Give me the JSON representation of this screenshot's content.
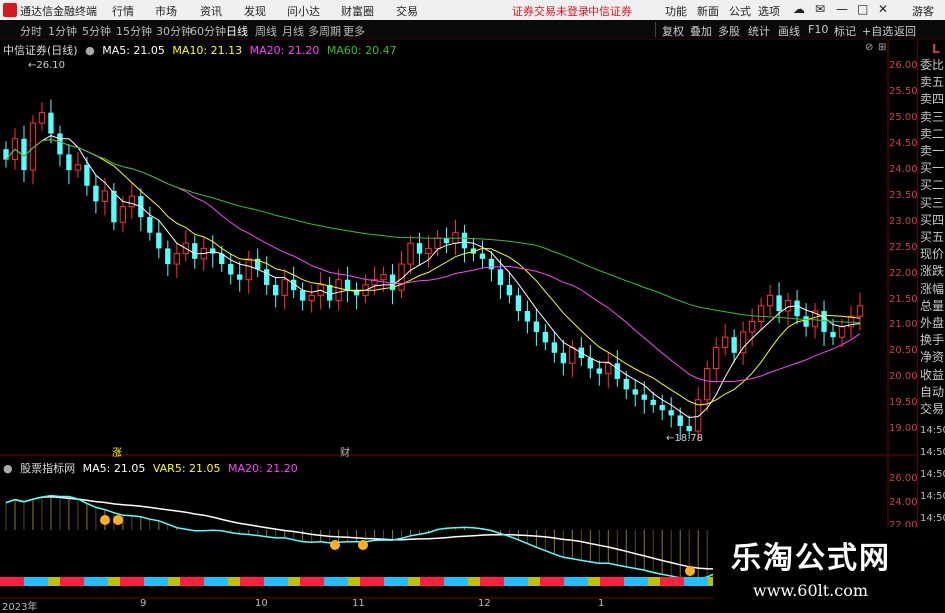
{
  "titlebar": {
    "app_name": "通达信金融终端",
    "menus": [
      "行情",
      "市场",
      "资讯",
      "发现",
      "问小达",
      "财富圈",
      "交易"
    ],
    "warning": "证券交易未登录",
    "broker": "中信证券",
    "right_menus": [
      "功能",
      "新面",
      "公式",
      "选项"
    ],
    "guest": "游客"
  },
  "toolbar": {
    "periods": [
      "分时",
      "1分钟",
      "5分钟",
      "15分钟",
      "30分钟",
      "60分钟",
      "日线",
      "周线",
      "月线",
      "多周期",
      "更多"
    ],
    "active_period": "日线",
    "right_buttons": [
      "复权",
      "叠加",
      "多股",
      "统计",
      "画线",
      "F10",
      "标记",
      "+自选",
      "返回"
    ]
  },
  "chart_header": {
    "title": "中信证券(日线)",
    "ma5": "MA5: 21.05",
    "ma10": "MA10: 21.13",
    "ma20": "MA20: 21.20",
    "ma60": "MA60: 20.47"
  },
  "colors": {
    "up": "#ff3030",
    "down": "#54ffff",
    "ma5": "#ffffff",
    "ma10": "#ffff00",
    "ma20": "#ff40ff",
    "ma60": "#30c030",
    "axis": "#a00000"
  },
  "price_axis": [
    "26.00",
    "25.50",
    "25.00",
    "24.50",
    "24.00",
    "23.50",
    "23.00",
    "22.50",
    "22.00",
    "21.50",
    "21.00",
    "20.50",
    "20.00",
    "19.50",
    "19.00"
  ],
  "annotations": {
    "high": "26.10",
    "low": "18.78",
    "marker_a": "涨",
    "marker_b": "财"
  },
  "indicator_header": {
    "title": "股票指标网",
    "ma5": "MA5: 21.05",
    "var5": "VAR5: 21.05",
    "ma20": "MA20: 21.20"
  },
  "indicator_axis": [
    "26.00",
    "24.00",
    "22.00"
  ],
  "date_axis": [
    "2023年",
    "9",
    "10",
    "11",
    "12",
    "1"
  ],
  "right_panel": {
    "quote_items": [
      "委比",
      "卖五",
      "卖四",
      "卖三",
      "卖二",
      "卖一",
      "买一",
      "买二",
      "买三",
      "买四",
      "买五",
      "现价",
      "涨跌",
      "涨幅",
      "总量",
      "外盘",
      "换手",
      "净资",
      "收益",
      "自动",
      "交易"
    ],
    "times": [
      "14:50",
      "14:50",
      "14:50",
      "14:50",
      "14:50",
      "14:50",
      "14:50",
      "14:50"
    ],
    "marker": "L"
  },
  "watermark": {
    "line1": "乐淘公式网",
    "line2": "www.60lt.com"
  },
  "chart_data": {
    "type": "candlestick",
    "title": "中信证券(日线)",
    "ylim": [
      18.6,
      26.3
    ],
    "x_labels": [
      "2023年",
      "9",
      "10",
      "11",
      "12",
      "1"
    ],
    "closes": [
      24.2,
      24.6,
      24.0,
      24.9,
      25.1,
      24.7,
      24.3,
      24.0,
      24.1,
      23.7,
      23.4,
      23.6,
      23.0,
      23.3,
      23.5,
      23.1,
      22.8,
      22.5,
      22.2,
      22.4,
      22.6,
      22.3,
      22.5,
      22.4,
      22.2,
      22.0,
      21.9,
      22.3,
      22.1,
      21.8,
      21.6,
      21.9,
      21.7,
      21.5,
      21.6,
      21.8,
      21.5,
      21.9,
      21.7,
      21.6,
      21.8,
      21.9,
      22.0,
      21.7,
      22.2,
      22.6,
      22.4,
      22.5,
      22.7,
      22.6,
      22.8,
      22.5,
      22.4,
      22.3,
      22.1,
      21.8,
      21.6,
      21.3,
      21.1,
      20.9,
      20.7,
      20.5,
      20.3,
      20.6,
      20.4,
      20.2,
      20.1,
      20.3,
      20.0,
      19.8,
      19.7,
      19.6,
      19.5,
      19.4,
      19.3,
      19.1,
      19.0,
      19.6,
      20.2,
      20.6,
      20.8,
      20.5,
      20.9,
      21.1,
      21.4,
      21.6,
      21.3,
      21.5,
      21.2,
      21.0,
      21.3,
      20.9,
      20.8,
      21.0,
      21.2,
      21.4
    ],
    "ma5_last": 21.05,
    "ma10_last": 21.13,
    "ma20_last": 21.2,
    "ma60_last": 20.47
  }
}
